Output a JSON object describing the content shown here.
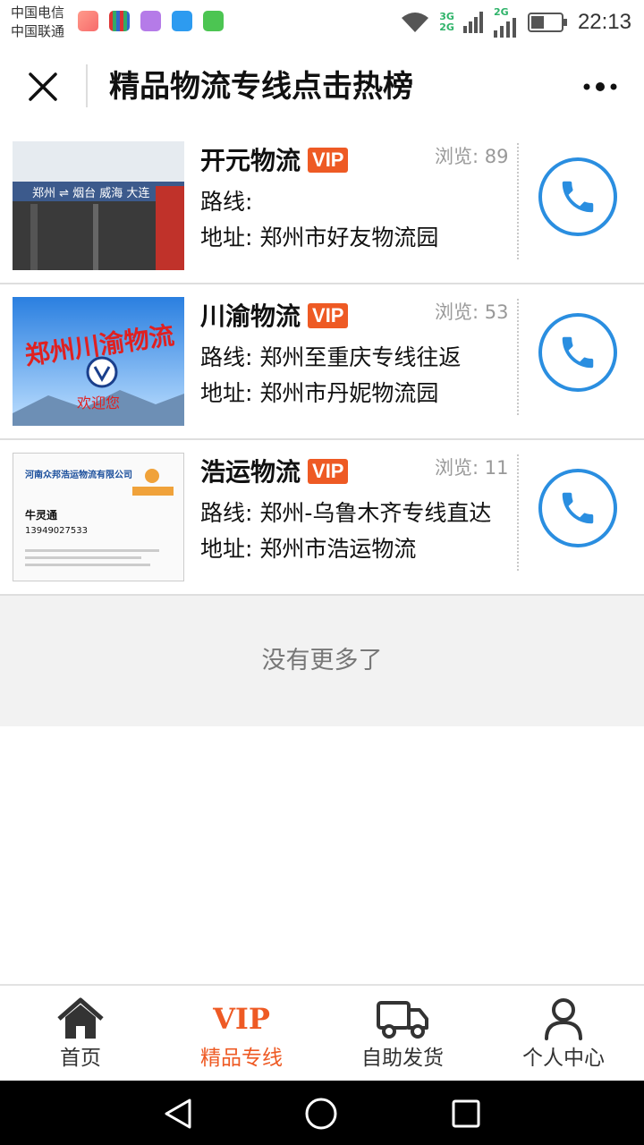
{
  "status_bar": {
    "carriers": [
      "中国电信",
      "中国联通"
    ],
    "network_top": "3G",
    "network_bottom": "2G",
    "network_right": "2G",
    "time": "22:13"
  },
  "header": {
    "title": "精品物流专线点击热榜"
  },
  "items": [
    {
      "name": "开元物流",
      "badge": "VIP",
      "views": "浏览: 89",
      "route": "路线:",
      "address": "地址: 郑州市好友物流园",
      "thumb_text": "郑州 ⇌ 烟台 威海 大连"
    },
    {
      "name": "川渝物流",
      "badge": "VIP",
      "views": "浏览: 53",
      "route": "路线: 郑州至重庆专线往返",
      "address": "地址: 郑州市丹妮物流园",
      "thumb_text": "郑州川渝物流",
      "thumb_sub": "欢迎您"
    },
    {
      "name": "浩运物流",
      "badge": "VIP",
      "views": "浏览: 11",
      "route": "路线: 郑州-乌鲁木齐专线直达",
      "address": "地址: 郑州市浩运物流",
      "thumb_text": "河南众邦浩运物流有限公司",
      "thumb_person": "牛灵通",
      "thumb_phone": "13949027533"
    }
  ],
  "footer_note": "没有更多了",
  "tabbar": {
    "tabs": [
      {
        "label": "首页",
        "icon": "home-icon"
      },
      {
        "label": "精品专线",
        "icon": "vip-icon",
        "icon_text": "VIP"
      },
      {
        "label": "自助发货",
        "icon": "truck-icon"
      },
      {
        "label": "个人中心",
        "icon": "user-icon"
      }
    ]
  },
  "colors": {
    "accent": "#ee5a24",
    "call_blue": "#2a8ee0"
  }
}
